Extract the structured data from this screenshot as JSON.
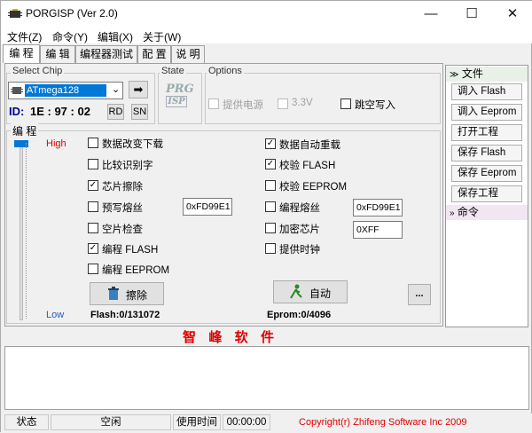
{
  "window": {
    "title": "PORGISP (Ver 2.0)",
    "minimize": "—",
    "maximize": "☐",
    "close": "✕"
  },
  "menu": [
    "文件(Z)",
    "命令(Y)",
    "编辑(X)",
    "关于(W)"
  ],
  "tabs": [
    "编 程",
    "编 辑",
    "编程器测试",
    "配 置",
    "说 明"
  ],
  "chip": {
    "group_label": "Select Chip",
    "selected": "ATmega128",
    "id_label": "ID:",
    "id_value": "1E : 97 : 02",
    "rd": "RD",
    "sn": "SN",
    "go_icon": "➡"
  },
  "state": {
    "label": "State",
    "logo_top": "PRG",
    "logo_bottom": "ISP"
  },
  "options": {
    "label": "Options",
    "power": "提供电源",
    "voltage": "3.3V",
    "jump": "跳空写入"
  },
  "program": {
    "label": "编 程",
    "high": "High",
    "low": "Low",
    "left": [
      {
        "text": "数据改变下载",
        "checked": false
      },
      {
        "text": "比较识别字",
        "checked": false
      },
      {
        "text": "芯片擦除",
        "checked": true
      },
      {
        "text": "预写熔丝",
        "checked": false
      },
      {
        "text": "空片检查",
        "checked": false
      },
      {
        "text": "编程 FLASH",
        "checked": true
      },
      {
        "text": "编程 EEPROM",
        "checked": false
      }
    ],
    "right": [
      {
        "text": "数据自动重载",
        "checked": true
      },
      {
        "text": "校验 FLASH",
        "checked": true
      },
      {
        "text": "校验 EEPROM",
        "checked": false
      },
      {
        "text": "编程熔丝",
        "checked": false
      },
      {
        "text": "加密芯片",
        "checked": false
      },
      {
        "text": "提供时钟",
        "checked": false
      }
    ],
    "fuse_pre": "0xFD99E1",
    "fuse_prog": "0xFD99E1",
    "lock": "0XFF",
    "erase_btn": "擦除",
    "auto_btn": "自动",
    "more_btn": "...",
    "flash_info": "Flash:0/131072",
    "eprom_info": "Eprom:0/4096",
    "brand": "智  峰  软  件"
  },
  "sidebar": {
    "file_head": "文件",
    "file_items": [
      "调入 Flash",
      "调入 Eeprom",
      "打开工程",
      "保存 Flash",
      "保存 Eeprom",
      "保存工程"
    ],
    "cmd_head": "命令"
  },
  "status": {
    "label": "状态",
    "state": "空闲",
    "time_label": "使用时间",
    "time": "00:00:00",
    "copyright": "Copyright(r) Zhifeng Software Inc 2009"
  },
  "colors": {
    "accent": "#0078d7",
    "red": "#e00000",
    "sidebar_head": "#e8f0e8",
    "cmd_head": "#f3e6f3"
  }
}
